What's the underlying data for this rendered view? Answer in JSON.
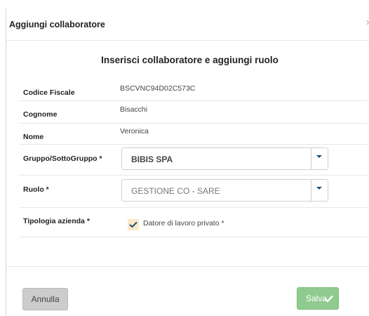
{
  "header": {
    "title": "Aggiungi collaboratore",
    "close_icon": "close-icon"
  },
  "subtitle": "Inserisci collaboratore e aggiungi ruolo",
  "fields": {
    "codice_fiscale": {
      "label": "Codice Fiscale",
      "value": "BSCVNC94D02C573C"
    },
    "cognome": {
      "label": "Cognome",
      "value": "Bisacchi"
    },
    "nome": {
      "label": "Nome",
      "value": "Veronica"
    },
    "gruppo": {
      "label": "Gruppo/SottoGruppo *",
      "value": "BIBIS SPA"
    },
    "ruolo": {
      "label": "Ruolo *",
      "value": "GESTIONE CO - SARE"
    },
    "tipologia": {
      "label": "Tipologia azienda *",
      "option": "Datore di lavoro privato *",
      "checked": true
    }
  },
  "buttons": {
    "cancel": "Annulla",
    "save": "Salva"
  },
  "colors": {
    "save_button": "#8fcb8f",
    "cancel_button": "#cccccc",
    "caret": "#1e4e79",
    "checkbox_bg": "#fbe8c8"
  }
}
